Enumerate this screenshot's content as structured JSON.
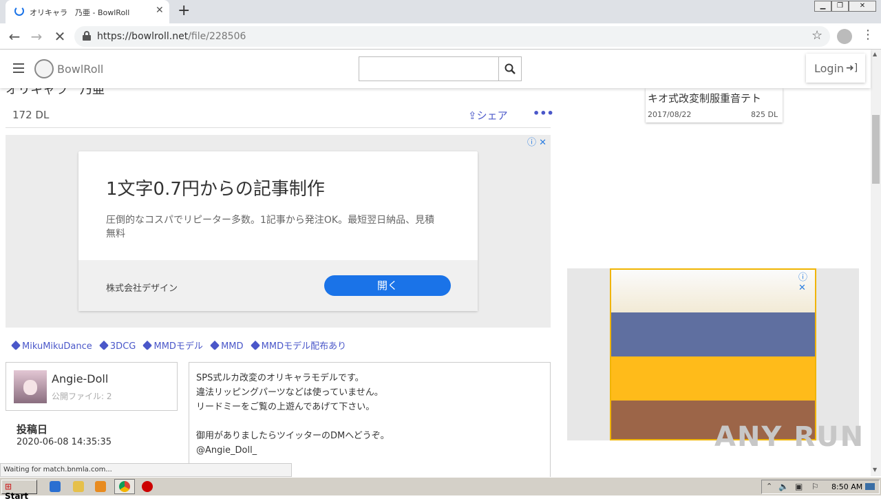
{
  "browser": {
    "tab_title": "オリキャラ　乃亜 - BowlRoll",
    "url_domain": "https://bowlroll.net",
    "url_path": "/file/228506",
    "status_text": "Waiting for match.bnmla.com..."
  },
  "header": {
    "logo": "BowlRoll",
    "search_placeholder": "",
    "login_label": "Login"
  },
  "file": {
    "title_cut": "オリキャラ　乃亜",
    "download_count": "172 DL",
    "share_label": "シェア",
    "more_label": "•••",
    "tags": [
      "MikuMikuDance",
      "3DCG",
      "MMDモデル",
      "MMD",
      "MMDモデル配布あり"
    ],
    "author": {
      "name": "Angie-Doll",
      "files": "公開ファイル: 2"
    },
    "post_label": "投稿日",
    "post_date": "2020-06-08 14:35:35",
    "description": [
      "SPS式ルカ改変のオリキャラモデルです。",
      "違法リッピングパーツなどは使っていません。",
      "リードミーをご覧の上遊んであげて下さい。",
      "",
      "御用がありましたらツイッターのDMへどうぞ。",
      "@Angie_Doll_"
    ]
  },
  "ad1": {
    "headline": "1文字0.7円からの記事制作",
    "body": "圧倒的なコスパでリピーター多数。1記事から発注OK。最短翌日納品、見積無料",
    "company": "株式会社デザイン",
    "cta": "開く",
    "adchoices": "ⓘ ✕"
  },
  "related": {
    "title": "キオ式改変制服重音テト",
    "date": "2017/08/22",
    "downloads": "825 DL"
  },
  "ad2": {
    "adchoices": "ⓘ ✕"
  },
  "watermark": "ANY RUN",
  "taskbar": {
    "start_label": "Start",
    "clock": "8:50 AM"
  },
  "colors": {
    "accent": "#4a57c9",
    "cta": "#1a73e8"
  }
}
